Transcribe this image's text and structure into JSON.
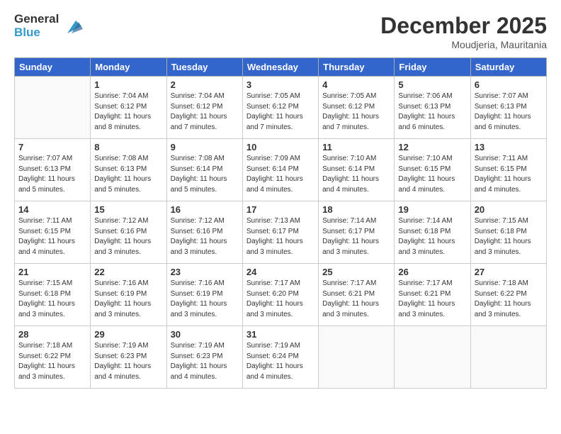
{
  "header": {
    "logo_general": "General",
    "logo_blue": "Blue",
    "month": "December 2025",
    "location": "Moudjeria, Mauritania"
  },
  "days_of_week": [
    "Sunday",
    "Monday",
    "Tuesday",
    "Wednesday",
    "Thursday",
    "Friday",
    "Saturday"
  ],
  "weeks": [
    [
      {
        "day": "",
        "sunrise": "",
        "sunset": "",
        "daylight": ""
      },
      {
        "day": "1",
        "sunrise": "Sunrise: 7:04 AM",
        "sunset": "Sunset: 6:12 PM",
        "daylight": "Daylight: 11 hours and 8 minutes."
      },
      {
        "day": "2",
        "sunrise": "Sunrise: 7:04 AM",
        "sunset": "Sunset: 6:12 PM",
        "daylight": "Daylight: 11 hours and 7 minutes."
      },
      {
        "day": "3",
        "sunrise": "Sunrise: 7:05 AM",
        "sunset": "Sunset: 6:12 PM",
        "daylight": "Daylight: 11 hours and 7 minutes."
      },
      {
        "day": "4",
        "sunrise": "Sunrise: 7:05 AM",
        "sunset": "Sunset: 6:12 PM",
        "daylight": "Daylight: 11 hours and 7 minutes."
      },
      {
        "day": "5",
        "sunrise": "Sunrise: 7:06 AM",
        "sunset": "Sunset: 6:13 PM",
        "daylight": "Daylight: 11 hours and 6 minutes."
      },
      {
        "day": "6",
        "sunrise": "Sunrise: 7:07 AM",
        "sunset": "Sunset: 6:13 PM",
        "daylight": "Daylight: 11 hours and 6 minutes."
      }
    ],
    [
      {
        "day": "7",
        "sunrise": "Sunrise: 7:07 AM",
        "sunset": "Sunset: 6:13 PM",
        "daylight": "Daylight: 11 hours and 5 minutes."
      },
      {
        "day": "8",
        "sunrise": "Sunrise: 7:08 AM",
        "sunset": "Sunset: 6:13 PM",
        "daylight": "Daylight: 11 hours and 5 minutes."
      },
      {
        "day": "9",
        "sunrise": "Sunrise: 7:08 AM",
        "sunset": "Sunset: 6:14 PM",
        "daylight": "Daylight: 11 hours and 5 minutes."
      },
      {
        "day": "10",
        "sunrise": "Sunrise: 7:09 AM",
        "sunset": "Sunset: 6:14 PM",
        "daylight": "Daylight: 11 hours and 4 minutes."
      },
      {
        "day": "11",
        "sunrise": "Sunrise: 7:10 AM",
        "sunset": "Sunset: 6:14 PM",
        "daylight": "Daylight: 11 hours and 4 minutes."
      },
      {
        "day": "12",
        "sunrise": "Sunrise: 7:10 AM",
        "sunset": "Sunset: 6:15 PM",
        "daylight": "Daylight: 11 hours and 4 minutes."
      },
      {
        "day": "13",
        "sunrise": "Sunrise: 7:11 AM",
        "sunset": "Sunset: 6:15 PM",
        "daylight": "Daylight: 11 hours and 4 minutes."
      }
    ],
    [
      {
        "day": "14",
        "sunrise": "Sunrise: 7:11 AM",
        "sunset": "Sunset: 6:15 PM",
        "daylight": "Daylight: 11 hours and 4 minutes."
      },
      {
        "day": "15",
        "sunrise": "Sunrise: 7:12 AM",
        "sunset": "Sunset: 6:16 PM",
        "daylight": "Daylight: 11 hours and 3 minutes."
      },
      {
        "day": "16",
        "sunrise": "Sunrise: 7:12 AM",
        "sunset": "Sunset: 6:16 PM",
        "daylight": "Daylight: 11 hours and 3 minutes."
      },
      {
        "day": "17",
        "sunrise": "Sunrise: 7:13 AM",
        "sunset": "Sunset: 6:17 PM",
        "daylight": "Daylight: 11 hours and 3 minutes."
      },
      {
        "day": "18",
        "sunrise": "Sunrise: 7:14 AM",
        "sunset": "Sunset: 6:17 PM",
        "daylight": "Daylight: 11 hours and 3 minutes."
      },
      {
        "day": "19",
        "sunrise": "Sunrise: 7:14 AM",
        "sunset": "Sunset: 6:18 PM",
        "daylight": "Daylight: 11 hours and 3 minutes."
      },
      {
        "day": "20",
        "sunrise": "Sunrise: 7:15 AM",
        "sunset": "Sunset: 6:18 PM",
        "daylight": "Daylight: 11 hours and 3 minutes."
      }
    ],
    [
      {
        "day": "21",
        "sunrise": "Sunrise: 7:15 AM",
        "sunset": "Sunset: 6:18 PM",
        "daylight": "Daylight: 11 hours and 3 minutes."
      },
      {
        "day": "22",
        "sunrise": "Sunrise: 7:16 AM",
        "sunset": "Sunset: 6:19 PM",
        "daylight": "Daylight: 11 hours and 3 minutes."
      },
      {
        "day": "23",
        "sunrise": "Sunrise: 7:16 AM",
        "sunset": "Sunset: 6:19 PM",
        "daylight": "Daylight: 11 hours and 3 minutes."
      },
      {
        "day": "24",
        "sunrise": "Sunrise: 7:17 AM",
        "sunset": "Sunset: 6:20 PM",
        "daylight": "Daylight: 11 hours and 3 minutes."
      },
      {
        "day": "25",
        "sunrise": "Sunrise: 7:17 AM",
        "sunset": "Sunset: 6:21 PM",
        "daylight": "Daylight: 11 hours and 3 minutes."
      },
      {
        "day": "26",
        "sunrise": "Sunrise: 7:17 AM",
        "sunset": "Sunset: 6:21 PM",
        "daylight": "Daylight: 11 hours and 3 minutes."
      },
      {
        "day": "27",
        "sunrise": "Sunrise: 7:18 AM",
        "sunset": "Sunset: 6:22 PM",
        "daylight": "Daylight: 11 hours and 3 minutes."
      }
    ],
    [
      {
        "day": "28",
        "sunrise": "Sunrise: 7:18 AM",
        "sunset": "Sunset: 6:22 PM",
        "daylight": "Daylight: 11 hours and 3 minutes."
      },
      {
        "day": "29",
        "sunrise": "Sunrise: 7:19 AM",
        "sunset": "Sunset: 6:23 PM",
        "daylight": "Daylight: 11 hours and 4 minutes."
      },
      {
        "day": "30",
        "sunrise": "Sunrise: 7:19 AM",
        "sunset": "Sunset: 6:23 PM",
        "daylight": "Daylight: 11 hours and 4 minutes."
      },
      {
        "day": "31",
        "sunrise": "Sunrise: 7:19 AM",
        "sunset": "Sunset: 6:24 PM",
        "daylight": "Daylight: 11 hours and 4 minutes."
      },
      {
        "day": "",
        "sunrise": "",
        "sunset": "",
        "daylight": ""
      },
      {
        "day": "",
        "sunrise": "",
        "sunset": "",
        "daylight": ""
      },
      {
        "day": "",
        "sunrise": "",
        "sunset": "",
        "daylight": ""
      }
    ]
  ]
}
